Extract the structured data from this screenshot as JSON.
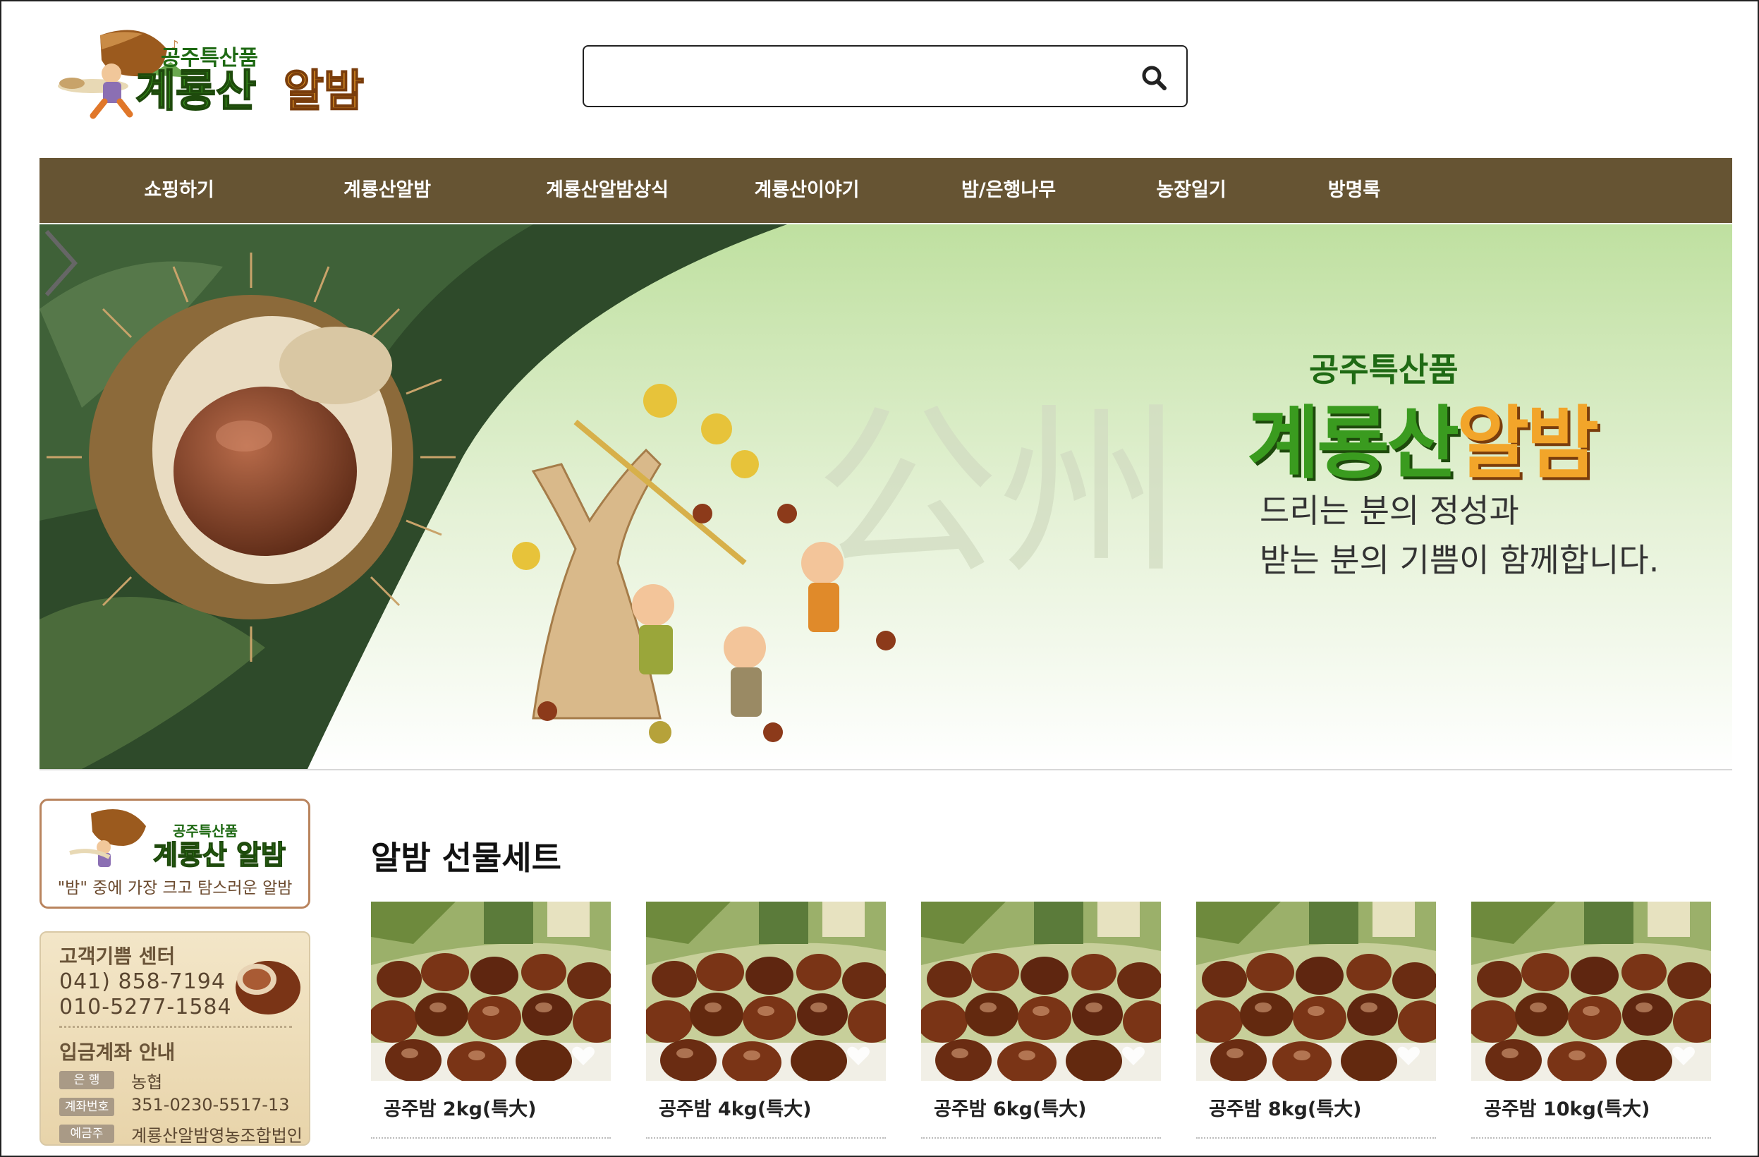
{
  "brand": {
    "sub": "공주특산품",
    "name_part1": "계룡산",
    "name_part2": "알밤"
  },
  "search": {
    "value": "",
    "placeholder": ""
  },
  "nav": {
    "items": [
      {
        "label": "쇼핑하기"
      },
      {
        "label": "계룡산알밤"
      },
      {
        "label": "계룡산알밤상식"
      },
      {
        "label": "계룡산이야기"
      },
      {
        "label": "밤/은행나무"
      },
      {
        "label": "농장일기"
      },
      {
        "label": "방명록"
      }
    ]
  },
  "hero": {
    "sub": "공주특산품",
    "name_part1": "계룡산",
    "name_part2": "알밤",
    "watermark": "公州",
    "line1": "드리는 분의 정성과",
    "line2": "받는 분의 기쁨이 함께합니다."
  },
  "sidebar": {
    "logo_sub": "공주특산품",
    "logo_name": "계룡산 알밤",
    "tagline": "\"밤\" 중에 가장 크고 탐스러운 알밤",
    "service_title": "고객기쁨 센터",
    "phone1": "041) 858-7194",
    "phone2": "010-5277-1584",
    "account_title": "입금계좌 안내",
    "rows": [
      {
        "label": "은 행",
        "value": "농협"
      },
      {
        "label": "계좌번호",
        "value": "351-0230-5517-13"
      },
      {
        "label": "예금주",
        "value": "계룡산알밤영농조합법인"
      }
    ]
  },
  "products": {
    "title": "알밤 선물세트",
    "items": [
      {
        "name": "공주밤 2kg(특大)"
      },
      {
        "name": "공주밤 4kg(특大)"
      },
      {
        "name": "공주밤 6kg(특大)"
      },
      {
        "name": "공주밤 8kg(특大)"
      },
      {
        "name": "공주밤 10kg(특大)"
      }
    ]
  },
  "colors": {
    "nav_bg": "#665433",
    "brand_green": "#3a9b1f",
    "brand_orange": "#f2a52a",
    "hero_bg": "#c5e3a8"
  },
  "icons": {
    "search": "search-icon",
    "next": "chevron-right-icon",
    "wishlist": "heart-icon"
  }
}
